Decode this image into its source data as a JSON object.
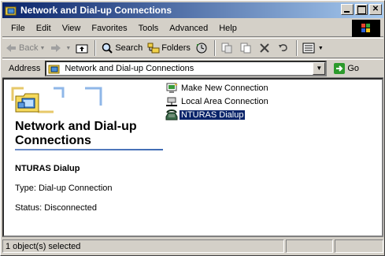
{
  "window": {
    "title": "Network and Dial-up Connections"
  },
  "menu": [
    "File",
    "Edit",
    "View",
    "Favorites",
    "Tools",
    "Advanced",
    "Help"
  ],
  "toolbar": {
    "back_label": "Back",
    "search_label": "Search",
    "folders_label": "Folders"
  },
  "address": {
    "label": "Address",
    "value": "Network and Dial-up Connections",
    "go_label": "Go"
  },
  "left_pane": {
    "title": "Network and Dial-up Connections",
    "selected_name": "NTURAS Dialup",
    "selected_type": "Type: Dial-up Connection",
    "selected_status": "Status: Disconnected"
  },
  "items": [
    {
      "label": "Make New Connection",
      "icon": "make-new-connection-icon"
    },
    {
      "label": "Local Area Connection",
      "icon": "local-area-connection-icon"
    },
    {
      "label": "NTURAS Dialup",
      "icon": "dialup-connection-icon",
      "selected": true
    }
  ],
  "status": {
    "text": "1 object(s) selected"
  },
  "colors": {
    "titlebar_start": "#0a246a",
    "titlebar_end": "#a6caf0",
    "selection": "#0a246a",
    "chrome": "#d4d0c8"
  }
}
